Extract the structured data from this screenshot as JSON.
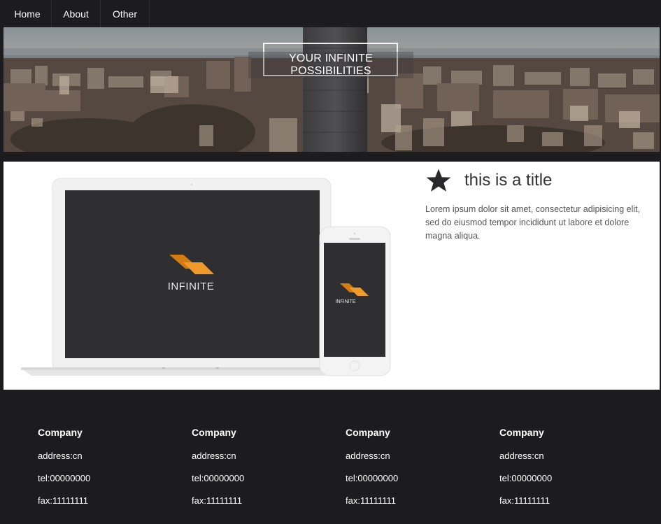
{
  "nav": {
    "items": [
      {
        "label": "Home"
      },
      {
        "label": "About"
      },
      {
        "label": "Other"
      }
    ]
  },
  "hero": {
    "title": "YOUR INFINITE POSSIBILITIES"
  },
  "devices": {
    "laptop_brand": "INFINITE",
    "phone_brand": "INFINITE"
  },
  "feature": {
    "icon": "star-icon",
    "title": "this is a title",
    "text": "Lorem ipsum dolor sit amet, consectetur adipisicing elit, sed do eiusmod tempor incididunt ut labore et dolore magna aliqua."
  },
  "footer": {
    "columns": [
      {
        "title": "Company",
        "address": "address:cn",
        "tel": "tel:00000000",
        "fax": "fax:11111111"
      },
      {
        "title": "Company",
        "address": "address:cn",
        "tel": "tel:00000000",
        "fax": "fax:11111111"
      },
      {
        "title": "Company",
        "address": "address:cn",
        "tel": "tel:00000000",
        "fax": "fax:11111111"
      },
      {
        "title": "Company",
        "address": "address:cn",
        "tel": "tel:00000000",
        "fax": "fax:11111111"
      }
    ]
  },
  "colors": {
    "nav_bg": "#1c1c1e",
    "footer_bg": "#1c1c1e",
    "brand_orange": "#e08a1e",
    "screen_dark": "#2f2f31"
  }
}
